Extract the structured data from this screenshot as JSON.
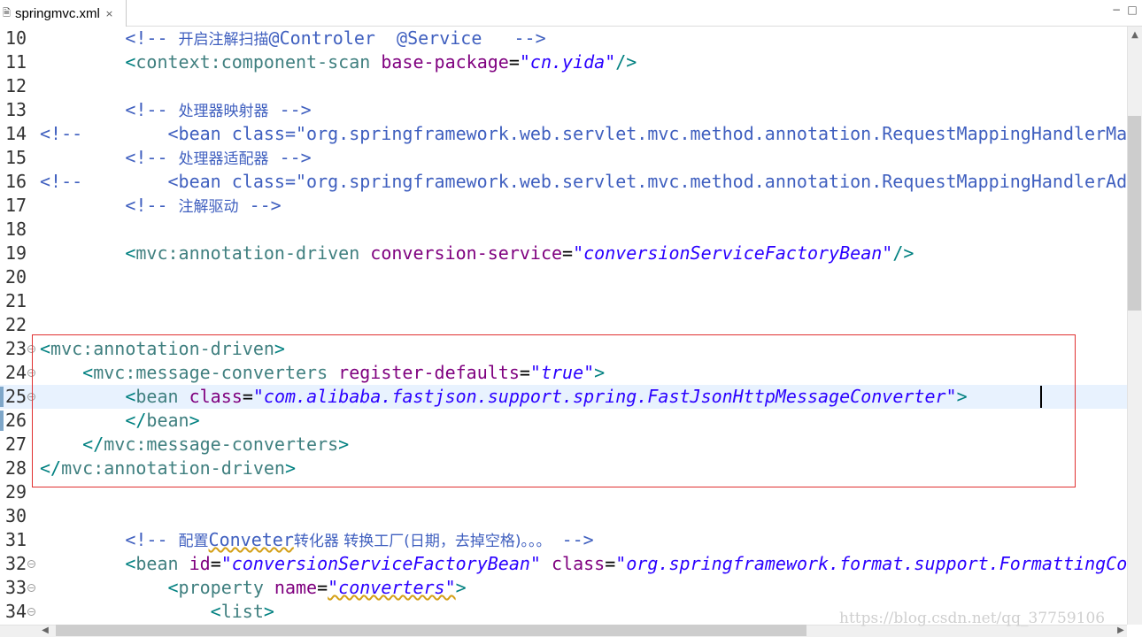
{
  "tab": {
    "icon": "xml-file-icon",
    "title": "springmvc.xml",
    "close": "×"
  },
  "window": {
    "minimize": "−",
    "maximize": "□"
  },
  "editor": {
    "lines": [
      {
        "n": "10",
        "tokens": [
          [
            "ws",
            "        "
          ],
          [
            "comment",
            "<!-- "
          ],
          [
            "commentcjk",
            "开启注解扫描"
          ],
          [
            "comment",
            "@Controler  @Service   -->"
          ]
        ]
      },
      {
        "n": "11",
        "tokens": [
          [
            "ws",
            "        "
          ],
          [
            "bracket",
            "<"
          ],
          [
            "tag",
            "context:component-scan"
          ],
          [
            "ws",
            " "
          ],
          [
            "attr",
            "base-package"
          ],
          [
            "eq",
            "="
          ],
          [
            "val",
            "\"cn.yida\""
          ],
          [
            "bracket",
            "/>"
          ]
        ]
      },
      {
        "n": "12",
        "tokens": []
      },
      {
        "n": "13",
        "tokens": [
          [
            "ws",
            "        "
          ],
          [
            "comment",
            "<!-- "
          ],
          [
            "commentcjk",
            "处理器映射器"
          ],
          [
            "comment",
            " -->"
          ]
        ]
      },
      {
        "n": "14",
        "tokens": [
          [
            "comment",
            "<!--        <bean class=\"org.springframework.web.servlet.mvc.method.annotation.RequestMappingHandlerMapping\"/> -->"
          ]
        ]
      },
      {
        "n": "15",
        "tokens": [
          [
            "ws",
            "        "
          ],
          [
            "comment",
            "<!-- "
          ],
          [
            "commentcjk",
            "处理器适配器"
          ],
          [
            "comment",
            " -->"
          ]
        ]
      },
      {
        "n": "16",
        "tokens": [
          [
            "comment",
            "<!--        <bean class=\"org.springframework.web.servlet.mvc.method.annotation.RequestMappingHandlerAdapter\"/> -->"
          ]
        ]
      },
      {
        "n": "17",
        "tokens": [
          [
            "ws",
            "        "
          ],
          [
            "comment",
            "<!-- "
          ],
          [
            "commentcjk",
            "注解驱动"
          ],
          [
            "comment",
            " -->"
          ]
        ]
      },
      {
        "n": "18",
        "tokens": []
      },
      {
        "n": "19",
        "tokens": [
          [
            "ws",
            "        "
          ],
          [
            "bracket",
            "<"
          ],
          [
            "tag",
            "mvc:annotation-driven"
          ],
          [
            "ws",
            " "
          ],
          [
            "attr",
            "conversion-service"
          ],
          [
            "eq",
            "="
          ],
          [
            "val",
            "\"conversionServiceFactoryBean\""
          ],
          [
            "bracket",
            "/>"
          ]
        ]
      },
      {
        "n": "20",
        "tokens": []
      },
      {
        "n": "21",
        "tokens": []
      },
      {
        "n": "22",
        "tokens": []
      },
      {
        "n": "23",
        "fold": true,
        "tokens": [
          [
            "bracket",
            "<"
          ],
          [
            "tag",
            "mvc:annotation-driven"
          ],
          [
            "bracket",
            ">"
          ]
        ]
      },
      {
        "n": "24",
        "fold": true,
        "tokens": [
          [
            "ws",
            "    "
          ],
          [
            "bracket",
            "<"
          ],
          [
            "tag",
            "mvc:message-converters"
          ],
          [
            "ws",
            " "
          ],
          [
            "attr",
            "register-defaults"
          ],
          [
            "eq",
            "="
          ],
          [
            "val",
            "\"true\""
          ],
          [
            "bracket",
            ">"
          ]
        ]
      },
      {
        "n": "25",
        "fold": true,
        "current": true,
        "marker": true,
        "tokens": [
          [
            "ws",
            "        "
          ],
          [
            "bracket",
            "<"
          ],
          [
            "tag",
            "bean"
          ],
          [
            "ws",
            " "
          ],
          [
            "attr",
            "class"
          ],
          [
            "eq",
            "="
          ],
          [
            "val",
            "\"com.alibaba.fastjson.support.spring.FastJsonHttpMessageConverter\""
          ],
          [
            "bracket",
            ">"
          ]
        ]
      },
      {
        "n": "26",
        "marker": true,
        "tokens": [
          [
            "ws",
            "        "
          ],
          [
            "bracket",
            "</"
          ],
          [
            "tag",
            "bean"
          ],
          [
            "bracket",
            ">"
          ]
        ]
      },
      {
        "n": "27",
        "tokens": [
          [
            "ws",
            "    "
          ],
          [
            "bracket",
            "</"
          ],
          [
            "tag",
            "mvc:message-converters"
          ],
          [
            "bracket",
            ">"
          ]
        ]
      },
      {
        "n": "28",
        "tokens": [
          [
            "bracket",
            "</"
          ],
          [
            "tag",
            "mvc:annotation-driven"
          ],
          [
            "bracket",
            ">"
          ]
        ]
      },
      {
        "n": "29",
        "tokens": []
      },
      {
        "n": "30",
        "tokens": []
      },
      {
        "n": "31",
        "tokens": [
          [
            "ws",
            "        "
          ],
          [
            "comment",
            "<!-- "
          ],
          [
            "commentcjk",
            "配置"
          ],
          [
            "commentsq",
            "Conveter"
          ],
          [
            "commentcjk",
            "转化器 转换工厂(日期，去掉空格)。。。"
          ],
          [
            "comment",
            " -->"
          ]
        ]
      },
      {
        "n": "32",
        "fold": true,
        "tokens": [
          [
            "ws",
            "        "
          ],
          [
            "bracket",
            "<"
          ],
          [
            "tag",
            "bean"
          ],
          [
            "ws",
            " "
          ],
          [
            "attr",
            "id"
          ],
          [
            "eq",
            "="
          ],
          [
            "val",
            "\"conversionServiceFactoryBean\""
          ],
          [
            "ws",
            " "
          ],
          [
            "attr",
            "class"
          ],
          [
            "eq",
            "="
          ],
          [
            "val",
            "\"org.springframework.format.support.FormattingConversionServiceFactoryBean\""
          ],
          [
            "bracket",
            ">"
          ]
        ]
      },
      {
        "n": "33",
        "fold": true,
        "tokens": [
          [
            "ws",
            "            "
          ],
          [
            "bracket",
            "<"
          ],
          [
            "tag",
            "property"
          ],
          [
            "ws",
            " "
          ],
          [
            "attr",
            "name"
          ],
          [
            "eq",
            "="
          ],
          [
            "valsq",
            "\"converters\""
          ],
          [
            "bracket",
            ">"
          ]
        ]
      },
      {
        "n": "34",
        "fold": true,
        "tokens": [
          [
            "ws",
            "                "
          ],
          [
            "bracket",
            "<"
          ],
          [
            "tag",
            "list"
          ],
          [
            "bracket",
            ">"
          ]
        ]
      }
    ]
  },
  "watermark": "https://blog.csdn.net/qq_37759106"
}
